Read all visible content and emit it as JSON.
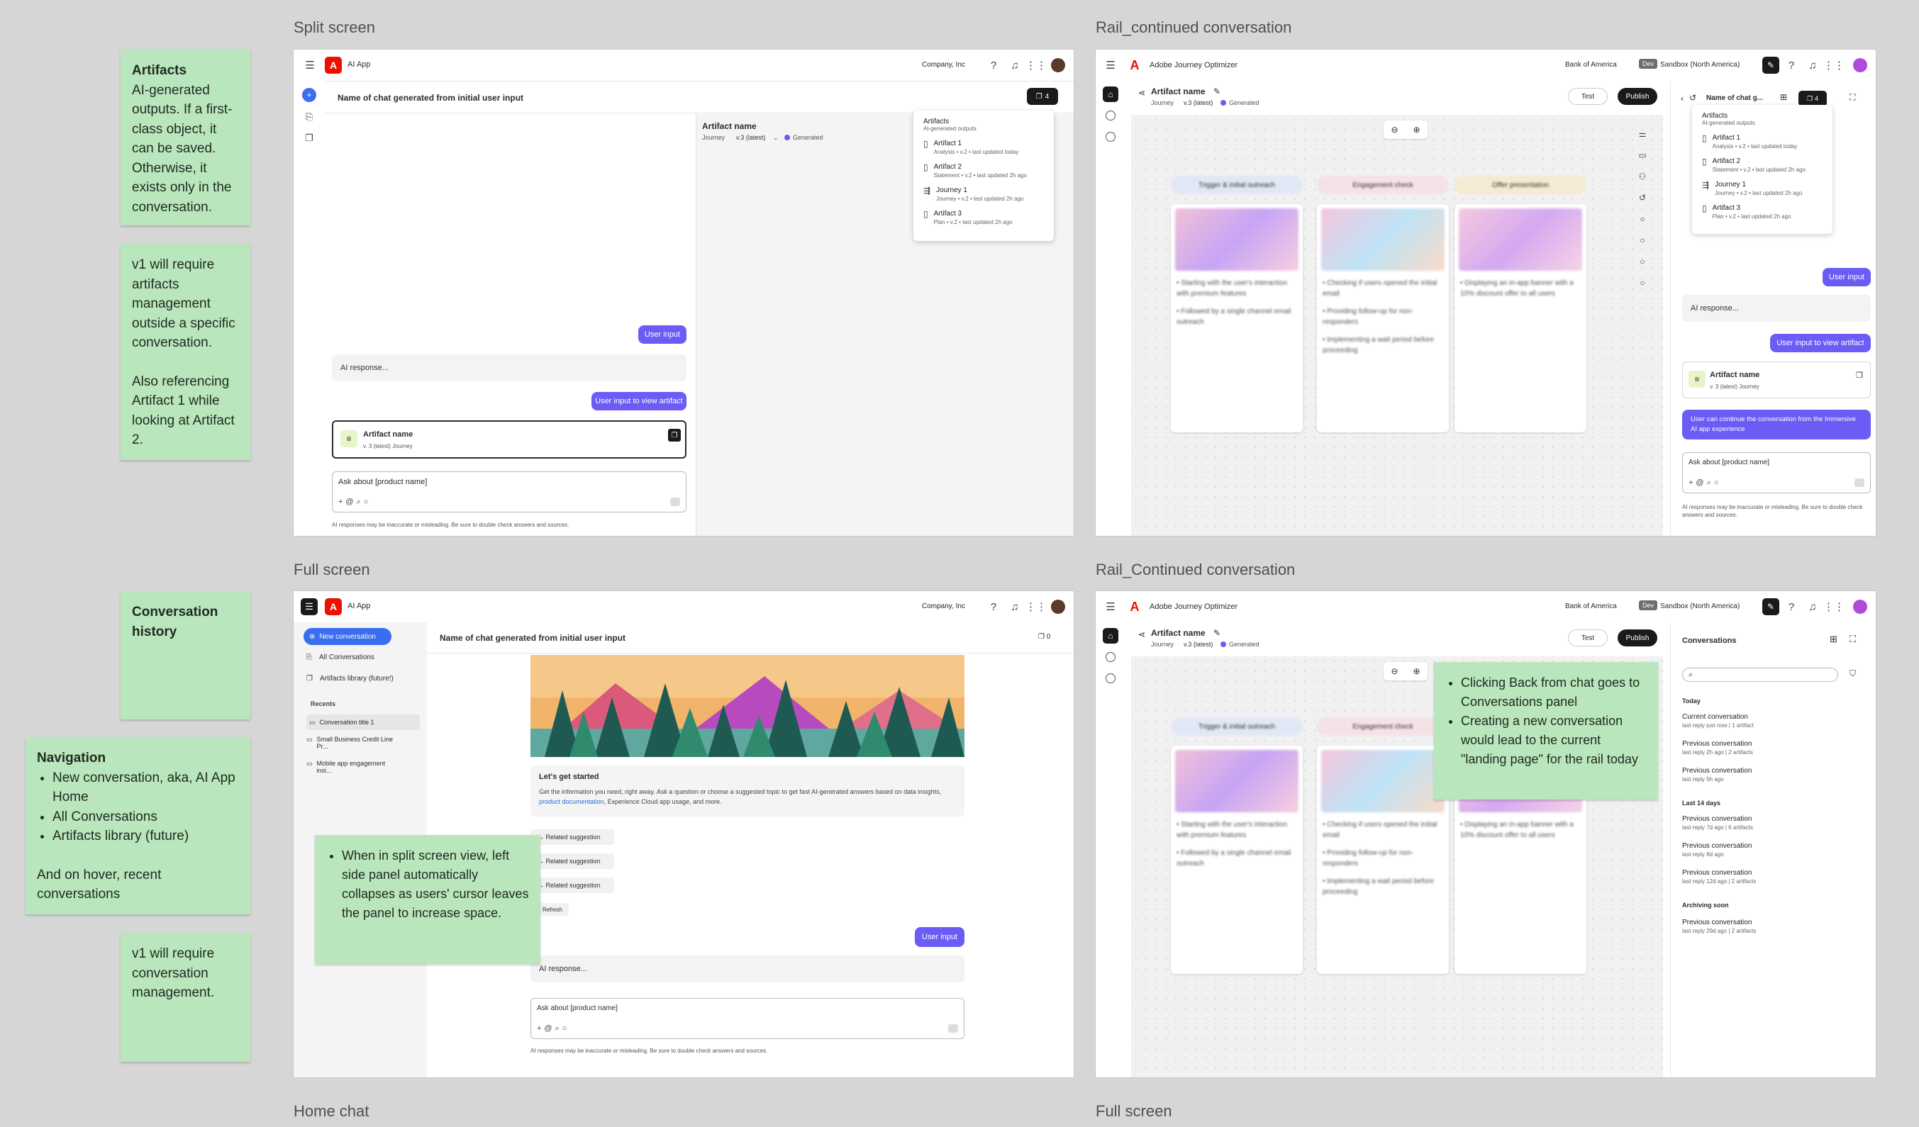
{
  "sections": {
    "split_screen": "Split screen",
    "rail_continued_1": "Rail_continued conversation",
    "full_screen_1": "Full screen",
    "rail_continued_2": "Rail_Continued conversation",
    "home_chat": "Home chat",
    "full_screen_2": "Full screen"
  },
  "stickies": {
    "artifacts_title": "Artifacts",
    "artifacts_body": "AI-generated outputs. If a first-class object, it can be saved. Otherwise, it exists only in the conversation.",
    "v1_artifacts_a": "v1 will require artifacts management outside a specific conversation.",
    "v1_artifacts_b": "Also referencing Artifact 1 while looking at Artifact 2.",
    "conv_history_title": "Conversation history",
    "nav_title": "Navigation",
    "nav_items": [
      "New conversation, aka, AI App Home",
      "All Conversations",
      "Artifacts library (future)"
    ],
    "nav_footer": "And on hover, recent conversations",
    "v1_conv": "v1 will require conversation management.",
    "split_note": "When in split screen view, left side panel automatically collapses as users' cursor leaves the panel to increase space.",
    "back_notes": [
      "Clicking Back from chat goes to Conversations panel",
      "Creating a new conversation would lead to the current \"landing page\" for the rail today"
    ]
  },
  "app": {
    "ai_app_title": "AI App",
    "company": "Company, Inc",
    "chat_title": "Name of chat generated from initial user input",
    "artifact_count": "4",
    "artifact_count_zero": "0",
    "user_input": "User input",
    "ai_response": "AI response...",
    "user_input_view": "User input to view artifact",
    "artifact_name": "Artifact name",
    "artifact_meta": "v. 3 (latest)   Journey",
    "ask_placeholder": "Ask about [product name]",
    "disclaimer": "AI responses may be inaccurate or misleading. Be sure to double check answers and sources.",
    "artifact_panel_type": "Journey",
    "artifact_panel_version": "v.3 (latest)",
    "generated": "Generated"
  },
  "artifacts_popup": {
    "title": "Artifacts",
    "subtitle": "AI-generated outputs",
    "items": [
      {
        "name": "Artifact 1",
        "meta": "Analysis • v.2 • last updated today"
      },
      {
        "name": "Artifact 2",
        "meta": "Statement • v.2 • last updated 2h ago"
      },
      {
        "name": "Journey 1",
        "meta": "Journey • v.2 • last updated 2h ago"
      },
      {
        "name": "Artifact 3",
        "meta": "Plan • v.2 • last updated 2h ago"
      }
    ]
  },
  "ajo": {
    "title": "Adobe Journey Optimizer",
    "org": "Bank of America",
    "env_badge": "Dev",
    "sandbox": "Sandbox (North America)",
    "test": "Test",
    "publish": "Publish",
    "rail_chat_title": "Name of chat g...",
    "stages": [
      "Trigger & initial outreach",
      "Engagement check",
      "Offer presentation"
    ],
    "stage_texts": [
      [
        "• Starting with the user's interaction with premium features",
        "• Followed by a single channel email outreach"
      ],
      [
        "• Checking if users opened the initial email",
        "• Providing follow-up for non-responders",
        "• Implementing a wait period before proceeding"
      ],
      [
        "• Displaying an in-app banner with a 10% discount offer to all users"
      ]
    ],
    "continue_msg": "User can continue the conversation from the Immersive AI app experience"
  },
  "fullscreen": {
    "new_conversation": "New conversation",
    "all_conversations": "All Conversations",
    "artifacts_library": "Artifacts library (future!)",
    "recents": "Recents",
    "recent_items": [
      "Conversation title 1",
      "Small Business Credit Line Pr...",
      "Mobile app engagement insi..."
    ],
    "lets_get_started": "Let's get started",
    "intro_a": "Get the information you need, right away. Ask a question or choose a suggested topic to get fast AI-generated answers based on data insights, ",
    "intro_link": "product documentation",
    "intro_b": ", Experience Cloud app usage, and more.",
    "related": "Related suggestion",
    "refresh": "Refresh"
  },
  "conversations": {
    "title": "Conversations",
    "today": "Today",
    "last14": "Last 14 days",
    "archiving": "Archiving soon",
    "items_today": [
      {
        "name": "Current conversation",
        "meta": "last reply just now | 1 artifact"
      },
      {
        "name": "Previous conversation",
        "meta": "last reply 2h ago | 2 artifacts"
      },
      {
        "name": "Previous conversation",
        "meta": "last reply 5h ago"
      }
    ],
    "items_14": [
      {
        "name": "Previous conversation",
        "meta": "last reply 7d ago | 6 artifacts"
      },
      {
        "name": "Previous conversation",
        "meta": "last reply 8d ago"
      },
      {
        "name": "Previous conversation",
        "meta": "last reply 12d ago | 2 artifacts"
      }
    ],
    "items_arch": [
      {
        "name": "Previous conversation",
        "meta": "last reply 29d ago | 2 artifacts"
      }
    ]
  }
}
